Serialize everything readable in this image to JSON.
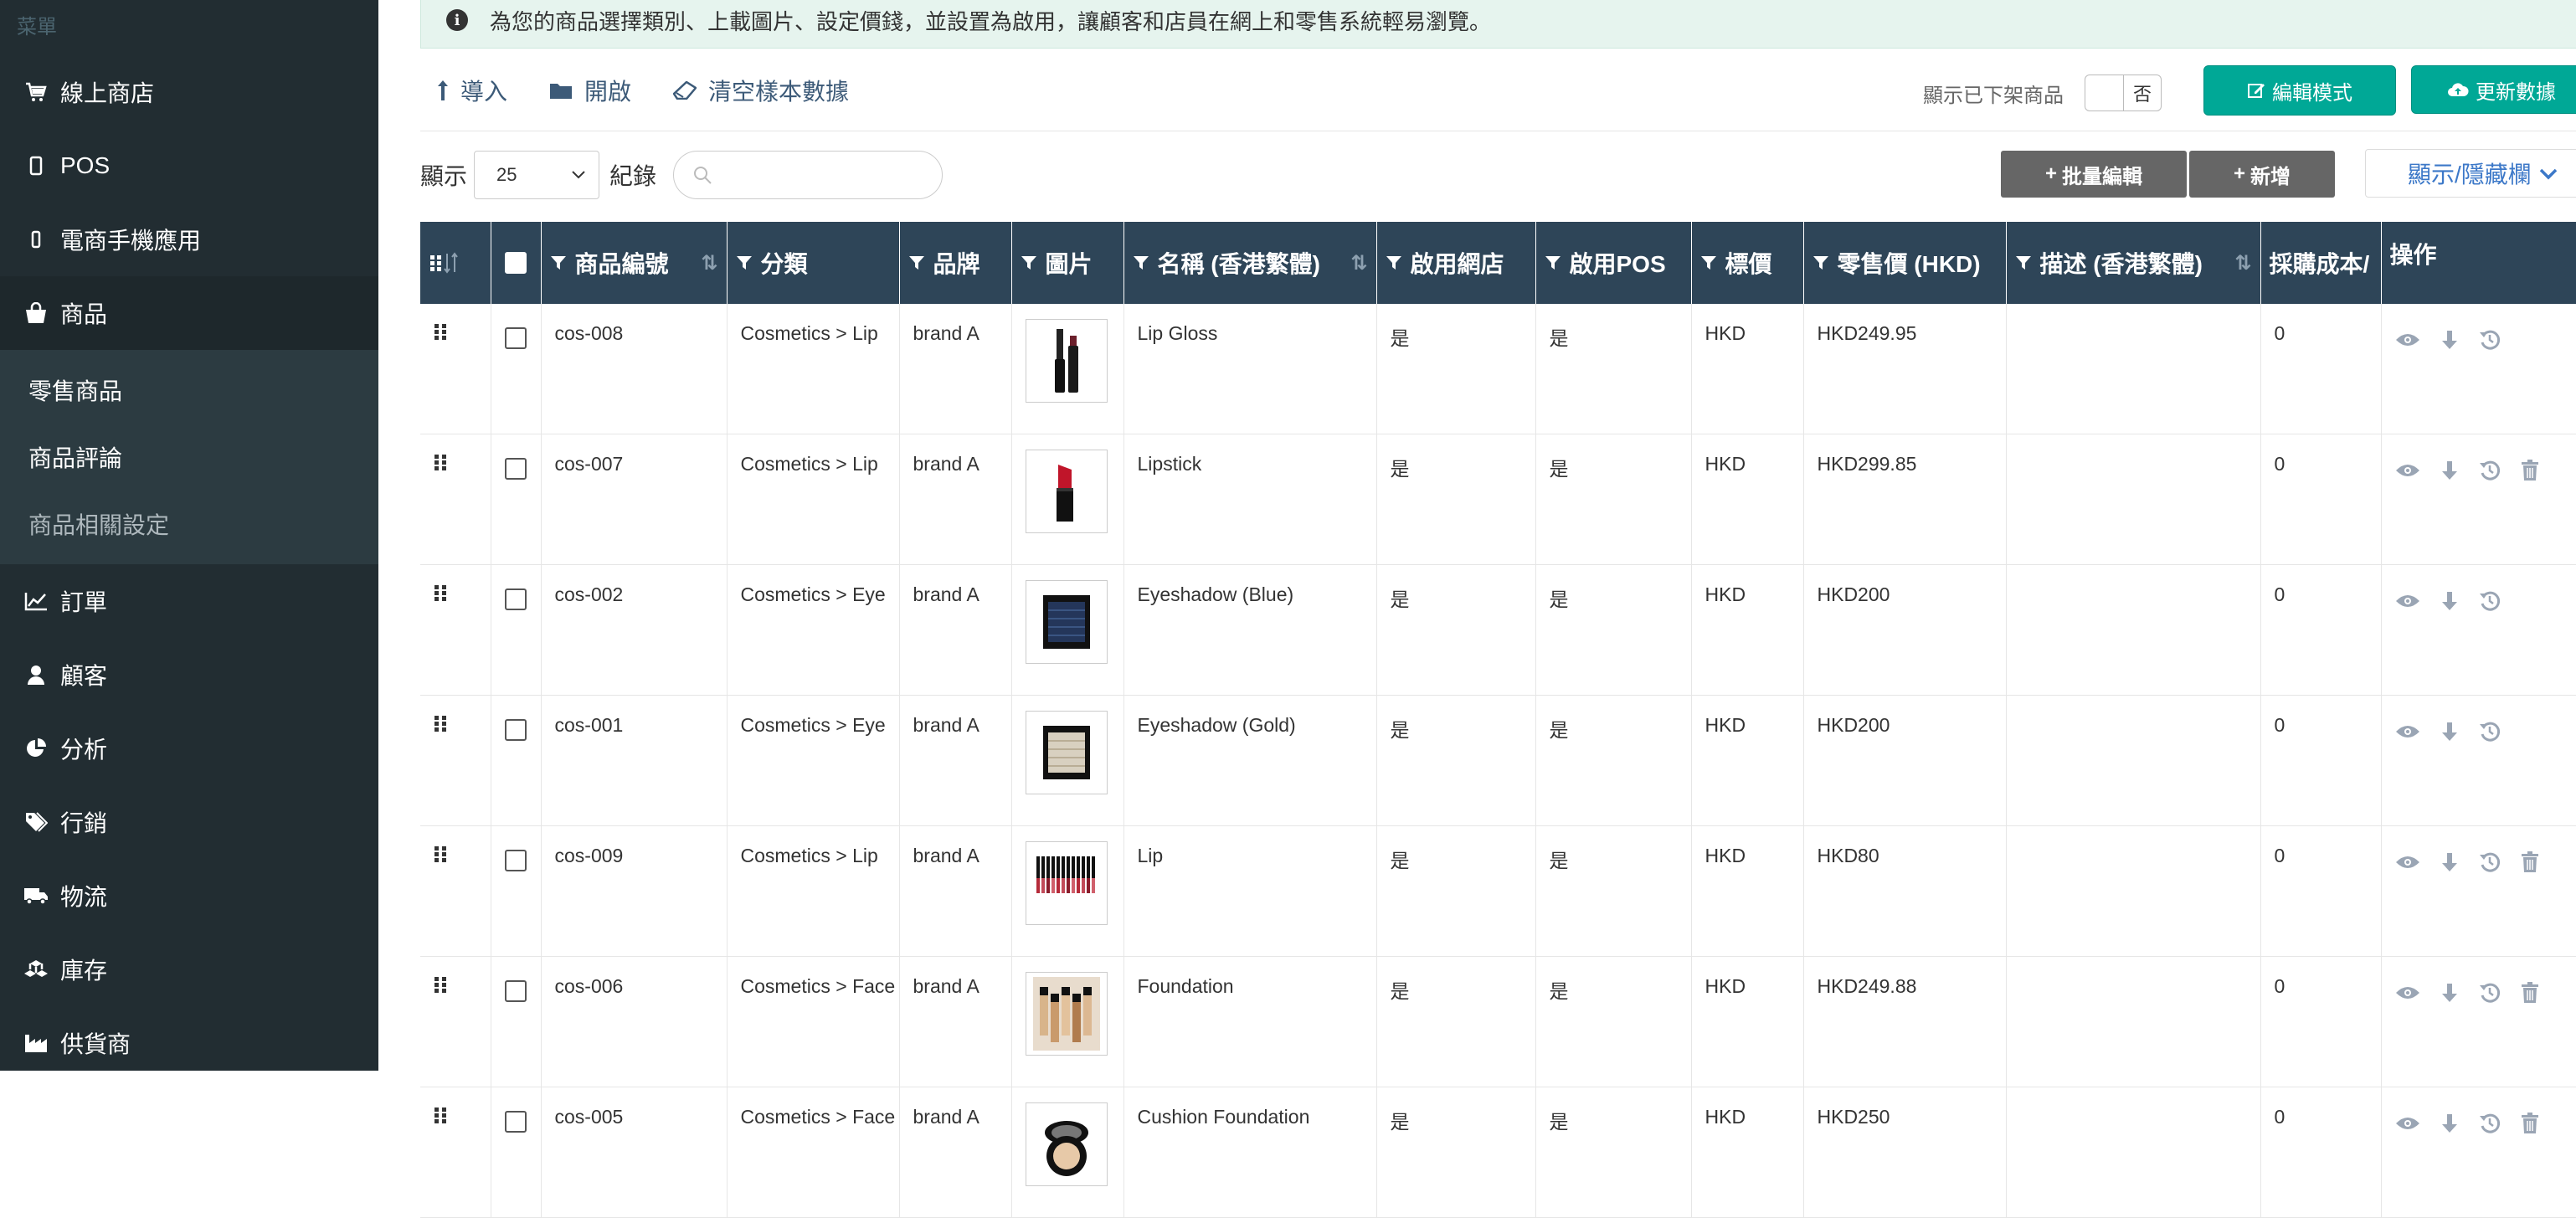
{
  "sidebar": {
    "header": "菜單",
    "items": [
      {
        "label": "線上商店",
        "icon": "cart-icon"
      },
      {
        "label": "POS",
        "icon": "tablet-icon"
      },
      {
        "label": "電商手機應用",
        "icon": "mobile-icon"
      },
      {
        "label": "商品",
        "icon": "shopping-bag-icon"
      }
    ],
    "sub_items": [
      {
        "label": "零售商品"
      },
      {
        "label": "商品評論"
      },
      {
        "label": "商品相關設定"
      }
    ],
    "items_after": [
      {
        "label": "訂單",
        "icon": "line-chart-icon"
      },
      {
        "label": "顧客",
        "icon": "user-icon"
      },
      {
        "label": "分析",
        "icon": "pie-chart-icon"
      },
      {
        "label": "行銷",
        "icon": "tags-icon"
      },
      {
        "label": "物流",
        "icon": "truck-icon"
      },
      {
        "label": "庫存",
        "icon": "cubes-icon"
      },
      {
        "label": "供貨商",
        "icon": "industry-icon"
      }
    ]
  },
  "alert": {
    "message": "為您的商品選擇類別、上載圖片、設定價錢，並設置為啟用，讓顧客和店員在網上和零售系統輕易瀏覽。",
    "close": "×"
  },
  "toolbar": {
    "import": "導入",
    "open": "開啟",
    "clear": "清空樣本數據",
    "show_offline": "顯示已下架商品",
    "toggle_value": "否",
    "edit_mode": "編輯模式",
    "update_data": "更新數據"
  },
  "list_controls": {
    "show": "顯示",
    "page_size": "25",
    "records": "紀錄",
    "search_placeholder": "",
    "bulk_edit": "批量編輯",
    "add_new": "新增",
    "show_hide_cols": "顯示/隱藏欄"
  },
  "table": {
    "headers": [
      "商品編號",
      "分類",
      "品牌",
      "圖片",
      "名稱 (香港繁體)",
      "啟用網店",
      "啟用POS",
      "標價",
      "零售價 (HKD)",
      "描述 (香港繁體)",
      "採購成本/",
      "操作"
    ],
    "rows": [
      {
        "code": "cos-008",
        "category": "Cosmetics > Lip",
        "brand": "brand A",
        "name": "Lip Gloss",
        "web": "是",
        "pos": "是",
        "currency": "HKD",
        "price": "HKD249.95",
        "desc": "",
        "cost": "0",
        "image": "lipgloss",
        "trash": false
      },
      {
        "code": "cos-007",
        "category": "Cosmetics > Lip",
        "brand": "brand A",
        "name": "Lipstick",
        "web": "是",
        "pos": "是",
        "currency": "HKD",
        "price": "HKD299.85",
        "desc": "",
        "cost": "0",
        "image": "lipstick",
        "trash": true
      },
      {
        "code": "cos-002",
        "category": "Cosmetics > Eye",
        "brand": "brand A",
        "name": "Eyeshadow (Blue)",
        "web": "是",
        "pos": "是",
        "currency": "HKD",
        "price": "HKD200",
        "desc": "",
        "cost": "0",
        "image": "eyeshadow-blue",
        "trash": false
      },
      {
        "code": "cos-001",
        "category": "Cosmetics > Eye",
        "brand": "brand A",
        "name": "Eyeshadow (Gold)",
        "web": "是",
        "pos": "是",
        "currency": "HKD",
        "price": "HKD200",
        "desc": "",
        "cost": "0",
        "image": "eyeshadow-gold",
        "trash": false
      },
      {
        "code": "cos-009",
        "category": "Cosmetics > Lip",
        "brand": "brand A",
        "name": "Lip",
        "web": "是",
        "pos": "是",
        "currency": "HKD",
        "price": "HKD80",
        "desc": "",
        "cost": "0",
        "image": "lip-set",
        "trash": true
      },
      {
        "code": "cos-006",
        "category": "Cosmetics > Face",
        "brand": "brand A",
        "name": "Foundation",
        "web": "是",
        "pos": "是",
        "currency": "HKD",
        "price": "HKD249.88",
        "desc": "",
        "cost": "0",
        "image": "foundation",
        "trash": true
      },
      {
        "code": "cos-005",
        "category": "Cosmetics > Face",
        "brand": "brand A",
        "name": "Cushion Foundation",
        "web": "是",
        "pos": "是",
        "currency": "HKD",
        "price": "HKD250",
        "desc": "",
        "cost": "0",
        "image": "cushion",
        "trash": true
      }
    ]
  },
  "colors": {
    "sidebar_bg": "#222d32",
    "table_header_bg": "#2e4558",
    "accent_green": "#00a896",
    "alert_bg": "#e6f4ee"
  }
}
